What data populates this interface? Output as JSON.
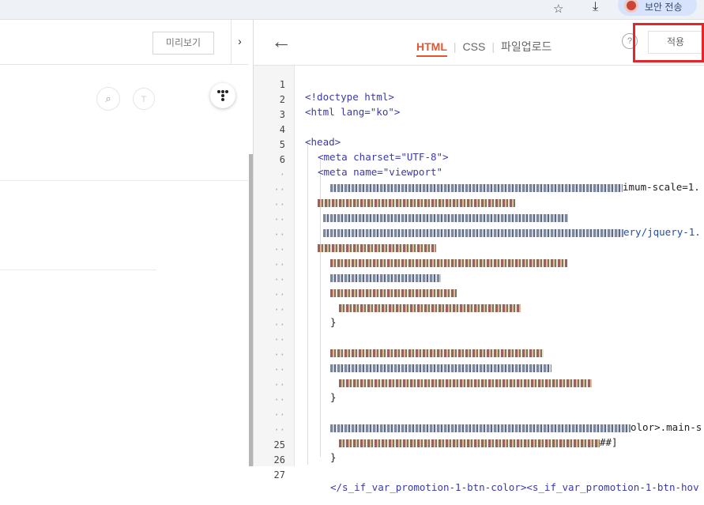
{
  "browser": {
    "profile_label": "보안 전송"
  },
  "left_panel": {
    "preview_label": "미리보기",
    "collapse_glyph": "›",
    "search_glyph": "⌕",
    "t_glyph": "T"
  },
  "editor_header": {
    "back_glyph": "←",
    "tabs": [
      {
        "label": "HTML",
        "active": true
      },
      {
        "label": "CSS",
        "active": false
      },
      {
        "label": "파일업로드",
        "active": false
      }
    ],
    "help_glyph": "?",
    "apply_label": "적용",
    "highlight_color": "#e3262a"
  },
  "code_lines": [
    {
      "n": "1",
      "text": "<!doctype html>"
    },
    {
      "n": "2",
      "text": "<html lang=\"ko\">"
    },
    {
      "n": "3",
      "text": ""
    },
    {
      "n": "4",
      "text": "<head>"
    },
    {
      "n": "5",
      "text": "<meta charset=\"UTF-8\">"
    },
    {
      "n": "6",
      "text": "<meta name=\"viewport\""
    },
    {
      "n": "",
      "text": "imum-scale=1."
    },
    {
      "n": "",
      "text": ""
    },
    {
      "n": "",
      "text": ""
    },
    {
      "n": "",
      "text": "ery/jquery-1."
    },
    {
      "n": "",
      "text": ""
    },
    {
      "n": "",
      "text": ""
    },
    {
      "n": "",
      "text": ""
    },
    {
      "n": "",
      "text": ""
    },
    {
      "n": "",
      "text": ""
    },
    {
      "n": "",
      "text": ""
    },
    {
      "n": "",
      "text": ""
    },
    {
      "n": "",
      "text": ""
    },
    {
      "n": "",
      "text": ""
    },
    {
      "n": "",
      "text": ""
    },
    {
      "n": "",
      "text": ""
    },
    {
      "n": "",
      "text": ""
    },
    {
      "n": "",
      "text": "olor>.main-s"
    },
    {
      "n": "",
      "text": "##]"
    },
    {
      "n": "25",
      "text": "}"
    },
    {
      "n": "26",
      "text": ""
    },
    {
      "n": "27",
      "text": "</s_if_var_promotion-1-btn-color><s_if_var_promotion-1-btn-hov"
    }
  ]
}
